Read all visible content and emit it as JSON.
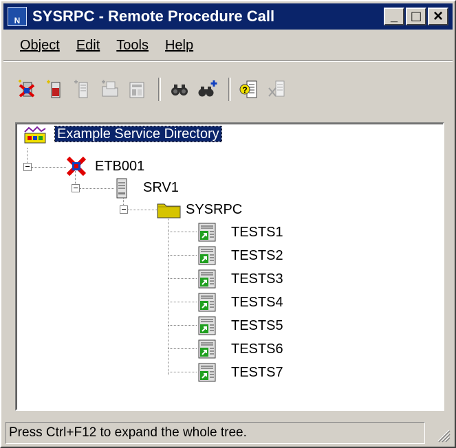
{
  "window": {
    "title": "SYSRPC - Remote Procedure Call",
    "app_icon_text": "N",
    "controls": {
      "minimize": "_",
      "maximize": "□",
      "close": "×"
    }
  },
  "menu": [
    "Object",
    "Edit",
    "Tools",
    "Help"
  ],
  "toolbar": {
    "groups": [
      [
        "new-server-icon",
        "new-node-icon",
        "new-service-icon",
        "new-folder-icon",
        "new-subprogram-icon"
      ],
      [
        "find-icon",
        "find-next-icon"
      ],
      [
        "properties-icon",
        "delete-icon"
      ]
    ]
  },
  "tree": {
    "root": {
      "label": "Example Service Directory",
      "icon": "service-directory-icon",
      "selected": true
    },
    "node": {
      "label": "ETB001",
      "icon": "node-icon"
    },
    "server": {
      "label": "SRV1",
      "icon": "server-icon"
    },
    "folder": {
      "label": "SYSRPC",
      "icon": "folder-icon"
    },
    "services": [
      "TESTS1",
      "TESTS2",
      "TESTS3",
      "TESTS4",
      "TESTS5",
      "TESTS6",
      "TESTS7"
    ]
  },
  "status": {
    "text": "Press Ctrl+F12 to expand the whole tree."
  },
  "colors": {
    "title_bar": "#0a246a",
    "window_face": "#d4d0c8",
    "selection": "#0a246a",
    "folder": "#d6c400",
    "node_red": "#e00000",
    "node_blue": "#1040c0"
  }
}
